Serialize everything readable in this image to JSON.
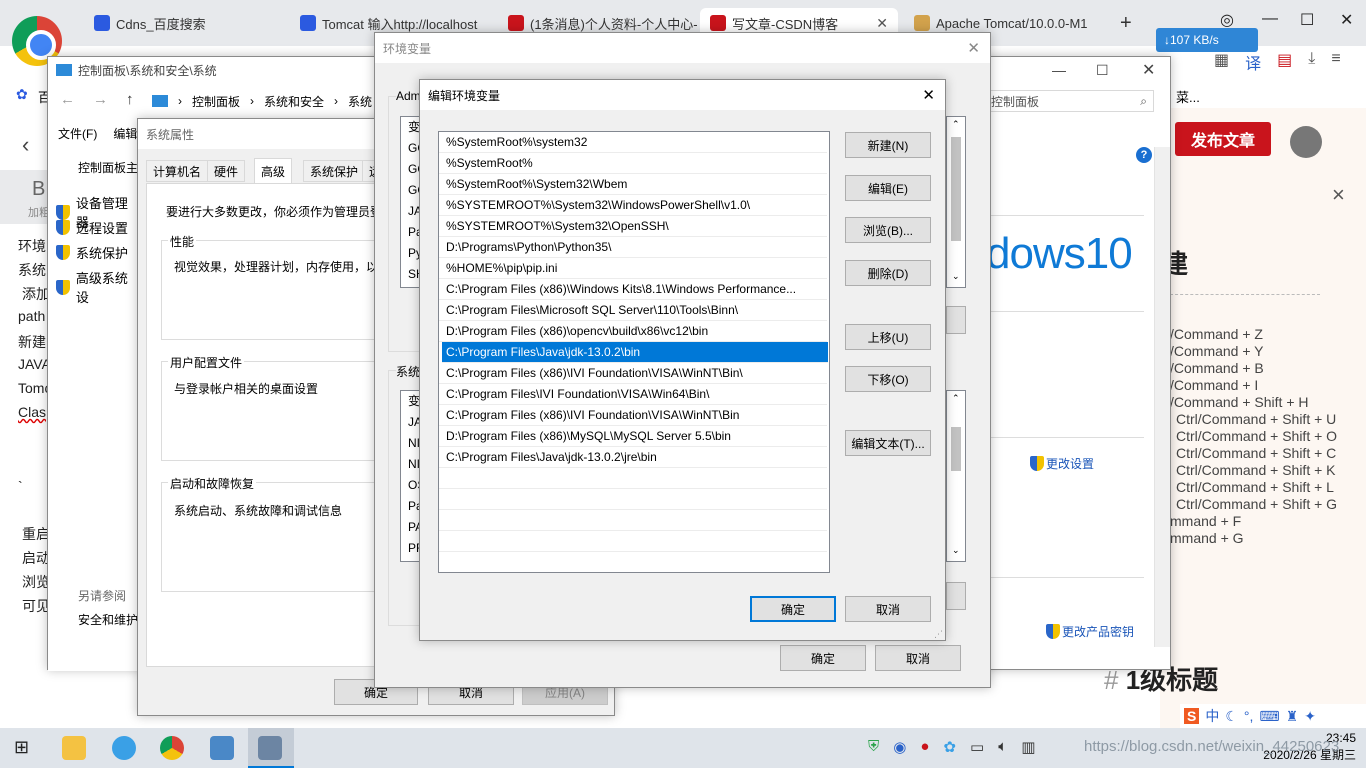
{
  "browser": {
    "tabs": [
      {
        "label": "Cdns_百度搜索",
        "color": "#2b5ae0"
      },
      {
        "label": "Tomcat 输入http://localhost",
        "color": "#2b5ae0"
      },
      {
        "label": "(1条消息)个人资料-个人中心-",
        "color": "#c9141c"
      },
      {
        "label": "写文章-CSDN博客",
        "color": "#c9141c"
      },
      {
        "label": "Apache Tomcat/10.0.0-M1",
        "color": "#d2a24c"
      }
    ],
    "new_tab": "+",
    "speed": "↓107 KB/s",
    "left_page_lines": [
      "环境",
      "系统",
      "添加",
      "path",
      "新建",
      "JAVA",
      "Tomc",
      "Clas",
      "`",
      "重启",
      "启动",
      "浏览",
      "可见"
    ],
    "left_page_head": "B",
    "left_page_sub": "加粗"
  },
  "csdn": {
    "publish": "发布文章",
    "close": "×",
    "title_fragment": "建",
    "shortcuts": [
      "/Command + Z",
      "/Command + Y",
      "/Command + B",
      "/Command + I",
      "/Command + Shift + H",
      "Ctrl/Command + Shift + U",
      "Ctrl/Command + Shift + O",
      "Ctrl/Command + Shift + C",
      "Ctrl/Command + Shift + K",
      "Ctrl/Command + Shift + L",
      "Ctrl/Command + Shift + G",
      "mmand + F",
      "mmand + G"
    ],
    "heading_hash": "#",
    "heading_text": "1级标题",
    "bookmark_fragment": "百",
    "bookmark_right": "菜..."
  },
  "control_panel": {
    "title": "控制面板\\系统和安全\\系统",
    "breadcrumb": [
      "控制面板",
      "系统和安全",
      "系统"
    ],
    "search_placeholder": "控制面板",
    "menu": [
      "文件(F)",
      "编辑"
    ],
    "home_link": "控制面板主",
    "side_links": [
      "设备管理器",
      "远程设置",
      "系统保护",
      "高级系统设"
    ],
    "see_also": "另请参阅",
    "see_also_link": "安全和维护",
    "change_settings": "更改设置",
    "change_key": "更改产品密钥",
    "win10": "dows10",
    "help": "?"
  },
  "system_properties": {
    "title": "系统属性",
    "tabs": [
      "计算机名",
      "硬件",
      "高级",
      "系统保护",
      "远"
    ],
    "intro": "要进行大多数更改，你必须作为管理员登",
    "groups": [
      {
        "label": "性能",
        "desc": "视觉效果，处理器计划，内存使用，以"
      },
      {
        "label": "用户配置文件",
        "desc": "与登录帐户相关的桌面设置"
      },
      {
        "label": "启动和故障恢复",
        "desc": "系统启动、系统故障和调试信息"
      }
    ],
    "buttons": {
      "ok": "确定",
      "cancel": "取消",
      "apply": "应用(A)"
    }
  },
  "env_vars": {
    "title": "环境变量",
    "user_section": "Adm",
    "user_rows": [
      "变",
      "GO",
      "GO",
      "GO",
      "JA",
      "Pa",
      "Py",
      "SH"
    ],
    "system_section": "系统",
    "system_rows": [
      "变",
      "JA",
      "NI",
      "NI",
      "OS",
      "Pa",
      "PA",
      "PR"
    ],
    "buttons": {
      "ok": "确定",
      "cancel": "取消"
    }
  },
  "edit_dialog": {
    "title": "编辑环境变量",
    "close": "✕",
    "paths": [
      "%SystemRoot%\\system32",
      "%SystemRoot%",
      "%SystemRoot%\\System32\\Wbem",
      "%SYSTEMROOT%\\System32\\WindowsPowerShell\\v1.0\\",
      "%SYSTEMROOT%\\System32\\OpenSSH\\",
      "D:\\Programs\\Python\\Python35\\",
      "%HOME%\\pip\\pip.ini",
      "C:\\Program Files (x86)\\Windows Kits\\8.1\\Windows Performance...",
      "C:\\Program Files\\Microsoft SQL Server\\110\\Tools\\Binn\\",
      "D:\\Program Files (x86)\\opencv\\build\\x86\\vc12\\bin",
      "C:\\Program Files\\Java\\jdk-13.0.2\\bin",
      "C:\\Program Files (x86)\\IVI Foundation\\VISA\\WinNT\\Bin\\",
      "C:\\Program Files\\IVI Foundation\\VISA\\Win64\\Bin\\",
      "C:\\Program Files (x86)\\IVI Foundation\\VISA\\WinNT\\Bin",
      "D:\\Program Files (x86)\\MySQL\\MySQL Server 5.5\\bin",
      "C:\\Program Files\\Java\\jdk-13.0.2\\jre\\bin"
    ],
    "selected_index": 10,
    "buttons": {
      "new": "新建(N)",
      "edit": "编辑(E)",
      "browse": "浏览(B)...",
      "delete": "删除(D)",
      "move_up": "上移(U)",
      "move_down": "下移(O)",
      "edit_text": "编辑文本(T)...",
      "ok": "确定",
      "cancel": "取消"
    }
  },
  "taskbar": {
    "time": "23:45",
    "date": "2020/2/26 星期三",
    "watermark": "https://blog.csdn.net/weixin_44250623",
    "ime": "中"
  }
}
